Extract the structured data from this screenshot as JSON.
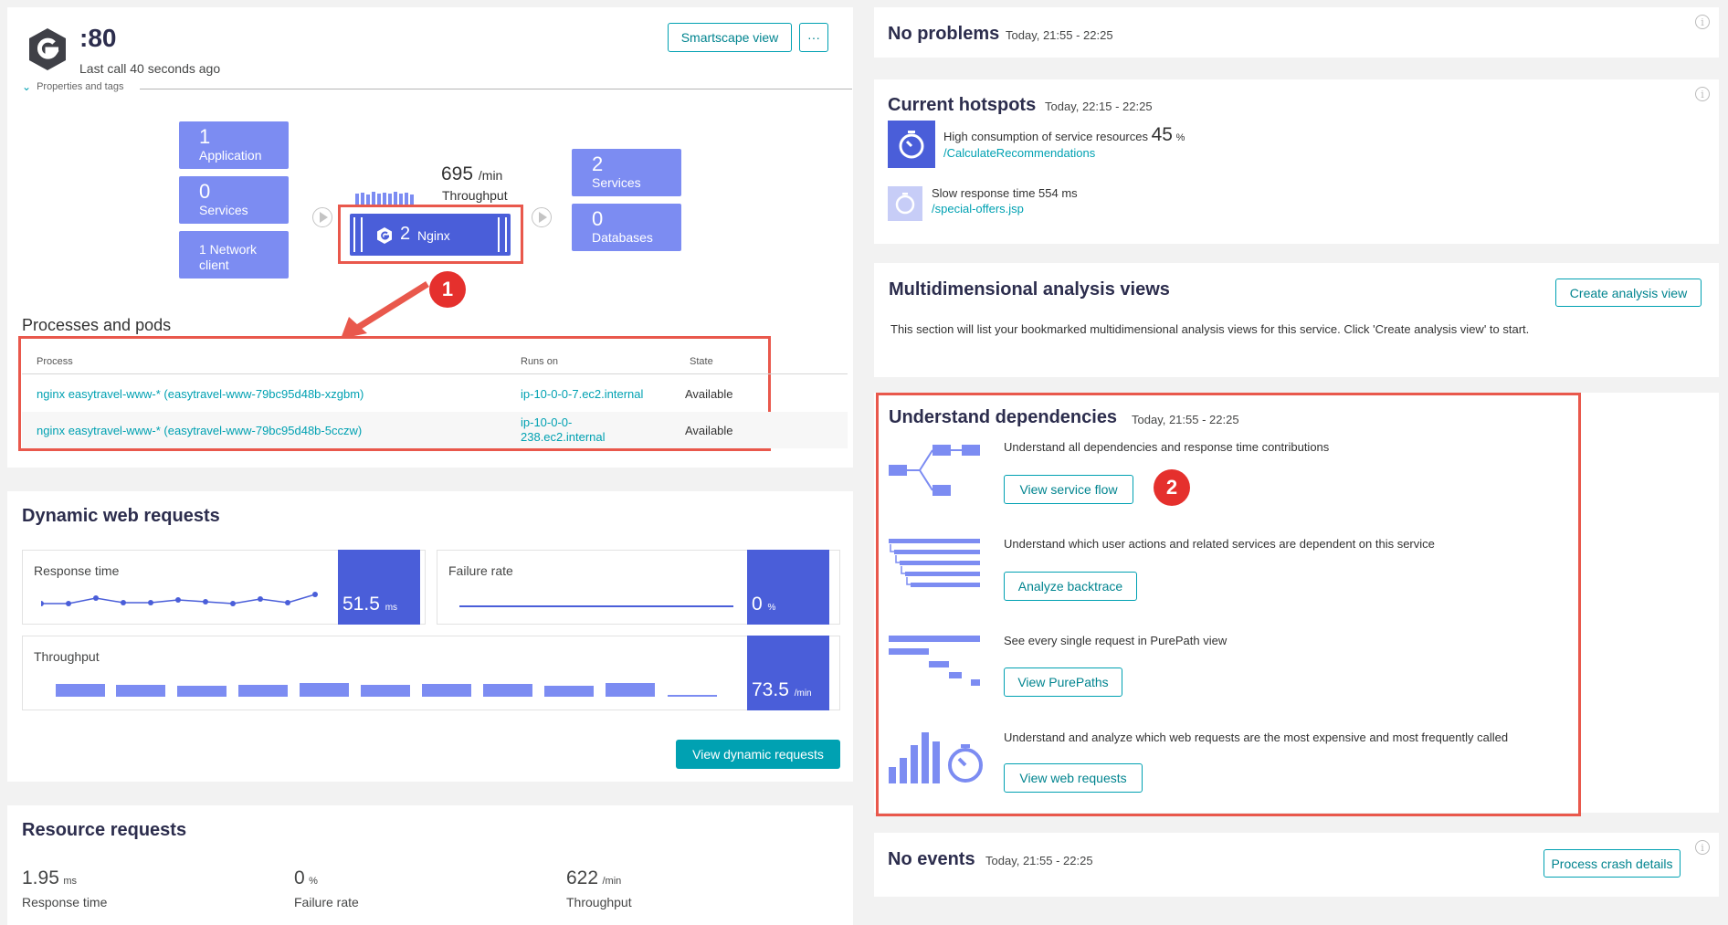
{
  "header": {
    "title": ":80",
    "last_call": "Last call 40 seconds ago",
    "smartscape_button": "Smartscape view",
    "more_button": "···",
    "properties_toggle": "Properties and tags"
  },
  "topology": {
    "left_tiles": [
      {
        "count": "1",
        "label": "Application"
      },
      {
        "count": "0",
        "label": "Services"
      },
      {
        "count": "",
        "label": "1 Network client"
      }
    ],
    "throughput_value": "695",
    "throughput_unit": "/min",
    "throughput_label": "Throughput",
    "center_count": "2",
    "center_label": "Nginx",
    "right_tiles": [
      {
        "count": "2",
        "label": "Services"
      },
      {
        "count": "0",
        "label": "Databases"
      }
    ]
  },
  "annotations": {
    "badge1": "1",
    "badge2": "2"
  },
  "processes": {
    "title": "Processes and pods",
    "columns": [
      "Process",
      "Runs on",
      "State"
    ],
    "rows": [
      {
        "process": "nginx easytravel-www-* (easytravel-www-79bc95d48b-xzgbm)",
        "host": "ip-10-0-0-7.ec2.internal",
        "state": "Available"
      },
      {
        "process": "nginx easytravel-www-* (easytravel-www-79bc95d48b-5cczw)",
        "host": "ip-10-0-0-238.ec2.internal",
        "state": "Available"
      }
    ]
  },
  "dynamic": {
    "title": "Dynamic web requests",
    "response_label": "Response time",
    "response_value": "51.5",
    "response_unit": "ms",
    "failure_label": "Failure rate",
    "failure_value": "0",
    "failure_unit": "%",
    "throughput_label": "Throughput",
    "throughput_value": "73.5",
    "throughput_unit": "/min",
    "button": "View dynamic requests"
  },
  "resource": {
    "title": "Resource requests",
    "items": [
      {
        "value": "1.95",
        "unit": "ms",
        "label": "Response time"
      },
      {
        "value": "0",
        "unit": "%",
        "label": "Failure rate"
      },
      {
        "value": "622",
        "unit": "/min",
        "label": "Throughput"
      }
    ]
  },
  "problems": {
    "title": "No problems",
    "time": "Today, 21:55 - 22:25"
  },
  "hotspots": {
    "title": "Current hotspots",
    "time": "Today, 22:15 - 22:25",
    "items": [
      {
        "text": "High consumption of service resources",
        "value": "45",
        "unit": "%",
        "link": "/CalculateRecommendations"
      },
      {
        "text": "Slow response time 554 ms",
        "link": "/special-offers.jsp"
      }
    ]
  },
  "mda": {
    "title": "Multidimensional analysis views",
    "button": "Create analysis view",
    "text": "This section will list your bookmarked multidimensional analysis views for this service. Click 'Create analysis view' to start."
  },
  "deps": {
    "title": "Understand dependencies",
    "time": "Today, 21:55 - 22:25",
    "items": [
      {
        "text": "Understand all dependencies and response time contributions",
        "button": "View service flow",
        "icon": "service-flow-icon"
      },
      {
        "text": "Understand which user actions and related services are dependent on this service",
        "button": "Analyze backtrace",
        "icon": "backtrace-icon"
      },
      {
        "text": "See every single request in PurePath view",
        "button": "View PurePaths",
        "icon": "purepath-icon"
      },
      {
        "text": "Understand and analyze which web requests are the most expensive and most frequently called",
        "button": "View web requests",
        "icon": "web-requests-icon"
      }
    ]
  },
  "events": {
    "title": "No events",
    "time": "Today, 21:55 - 22:25",
    "button": "Process crash details"
  },
  "colors": {
    "accent": "#00a1b2",
    "tile": "#7c8cf2",
    "dark_tile": "#4a5ed9",
    "annotation": "#e5302d"
  }
}
